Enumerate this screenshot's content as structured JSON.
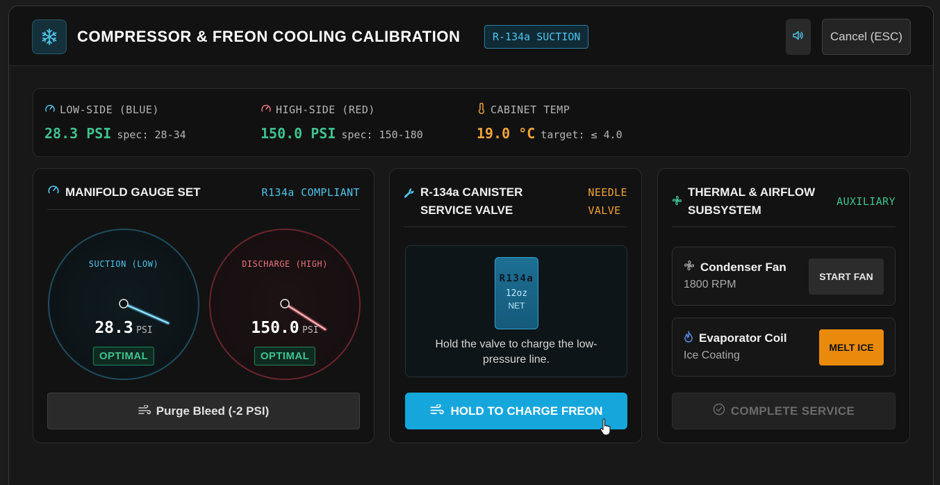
{
  "header": {
    "title": "COMPRESSOR & FREON COOLING CALIBRATION",
    "badge": "R-134a SUCTION",
    "cancel_label": "Cancel (ESC)",
    "app_icon": "snowflake-icon",
    "sound_icon": "speaker-icon"
  },
  "status": {
    "low": {
      "label": "LOW-SIDE (BLUE)",
      "value": "28.3 PSI",
      "spec": "spec: 28-34"
    },
    "high": {
      "label": "HIGH-SIDE (RED)",
      "value": "150.0 PSI",
      "spec": "spec: 150-180"
    },
    "cabinet": {
      "label": "CABINET TEMP",
      "value": "19.0 °C",
      "spec": "target: ≤ 4.0"
    }
  },
  "manifold": {
    "title": "MANIFOLD GAUGE SET",
    "tag": "R134a COMPLIANT",
    "low_gauge": {
      "label": "SUCTION (LOW)",
      "value": "28.3",
      "unit": "PSI",
      "status": "OPTIMAL"
    },
    "high_gauge": {
      "label": "DISCHARGE (HIGH)",
      "value": "150.0",
      "unit": "PSI",
      "status": "OPTIMAL"
    },
    "purge_label": "Purge Bleed (-2 PSI)"
  },
  "canister": {
    "title_line1": "R-134a CANISTER",
    "title_line2": "SERVICE VALVE",
    "tag_line1": "NEEDLE",
    "tag_line2": "VALVE",
    "can_brand": "R134a",
    "can_size": "12oz",
    "can_net": "NET",
    "hint": "Hold the valve to charge the low-pressure line.",
    "charge_label": "HOLD TO CHARGE FREON"
  },
  "thermal": {
    "title_line1": "THERMAL &",
    "title_line2": "AIRFLOW",
    "title_line3": "SUBSYSTEM",
    "tag": "AUXILIARY",
    "fan": {
      "name": "Condenser Fan",
      "value": "1800 RPM",
      "button": "START FAN"
    },
    "coil": {
      "name": "Evaporator Coil",
      "value": "Ice Coating",
      "button": "MELT ICE"
    },
    "complete_label": "COMPLETE SERVICE"
  },
  "colors": {
    "accent_blue": "#15a6dc",
    "ok_green": "#3fc28f",
    "warn_orange": "#f1a33a",
    "danger_red": "#e8747c"
  }
}
